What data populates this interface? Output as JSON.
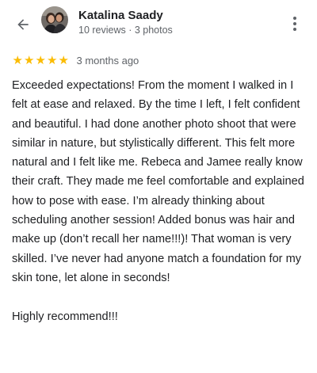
{
  "header": {
    "back_icon": "arrow-left-icon",
    "avatar": "reviewer-avatar",
    "reviewer_name": "Katalina Saady",
    "reviewer_stats": "10 reviews · 3 photos",
    "more_icon": "more-vertical-icon"
  },
  "review": {
    "rating": 5,
    "stars": [
      "★",
      "★",
      "★",
      "★",
      "★"
    ],
    "date": "3 months ago",
    "text": "Exceeded expectations! From the moment I walked in I felt at ease and relaxed. By the time I left, I felt confident and beautiful. I had done another photo shoot that were similar in nature, but stylistically different. This felt more natural and I felt like me. Rebeca and Jamee really know their craft. They made me feel comfortable and explained how to pose with ease. I’m already thinking about scheduling another session! Added bonus was hair and make up (don’t recall her name!!!)! That woman is very skilled. I’ve never had anyone match a foundation for my skin tone, let alone in seconds!\n\nHighly recommend!!!"
  },
  "colors": {
    "star": "#fbbc04",
    "primary_text": "#202124",
    "secondary_text": "#5f6368"
  }
}
